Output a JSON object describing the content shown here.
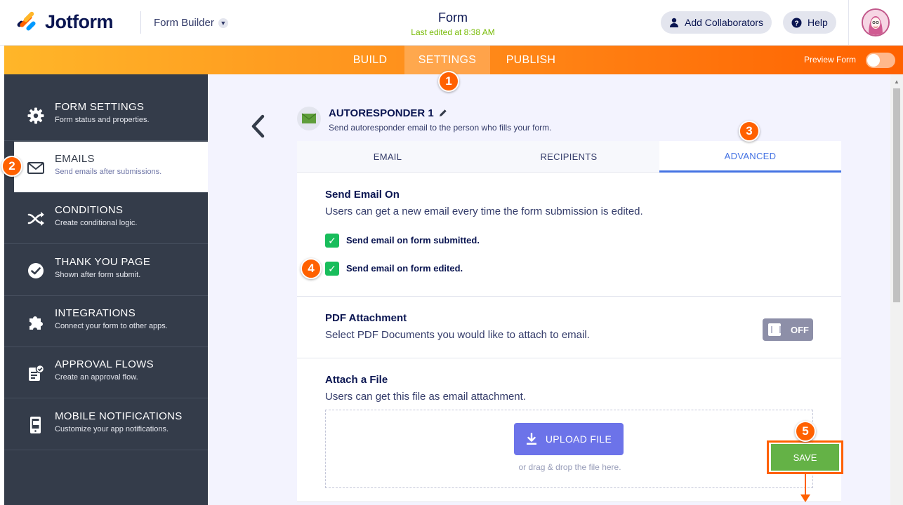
{
  "header": {
    "logo_text": "Jotform",
    "builder_label": "Form Builder",
    "form_title": "Form",
    "last_edited": "Last edited at 8:38 AM",
    "add_collaborators": "Add Collaborators",
    "help": "Help"
  },
  "nav": {
    "tabs": [
      {
        "label": "BUILD",
        "active": false
      },
      {
        "label": "SETTINGS",
        "active": true
      },
      {
        "label": "PUBLISH",
        "active": false
      }
    ],
    "preview_label": "Preview Form",
    "preview_on": false
  },
  "sidebar": {
    "items": [
      {
        "title": "FORM SETTINGS",
        "desc": "Form status and properties.",
        "icon": "gear-icon",
        "active": false
      },
      {
        "title": "EMAILS",
        "desc": "Send emails after submissions.",
        "icon": "envelope-icon",
        "active": true
      },
      {
        "title": "CONDITIONS",
        "desc": "Create conditional logic.",
        "icon": "shuffle-icon",
        "active": false
      },
      {
        "title": "THANK YOU PAGE",
        "desc": "Shown after form submit.",
        "icon": "check-circle-icon",
        "active": false
      },
      {
        "title": "INTEGRATIONS",
        "desc": "Connect your form to other apps.",
        "icon": "puzzle-icon",
        "active": false
      },
      {
        "title": "APPROVAL FLOWS",
        "desc": "Create an approval flow.",
        "icon": "approval-icon",
        "active": false
      },
      {
        "title": "MOBILE NOTIFICATIONS",
        "desc": "Customize your app notifications.",
        "icon": "mobile-icon",
        "active": false
      }
    ]
  },
  "autoresponder": {
    "title": "AUTORESPONDER 1",
    "subtitle": "Send autoresponder email to the person who fills your form."
  },
  "tabs": [
    {
      "label": "EMAIL",
      "active": false
    },
    {
      "label": "RECIPIENTS",
      "active": false
    },
    {
      "label": "ADVANCED",
      "active": true
    }
  ],
  "send_email_on": {
    "title": "Send Email On",
    "desc": "Users can get a new email every time the form submission is edited.",
    "options": [
      {
        "label": "Send email on form submitted.",
        "checked": true
      },
      {
        "label": "Send email on form edited.",
        "checked": true
      }
    ]
  },
  "pdf_attachment": {
    "title": "PDF Attachment",
    "desc": "Select PDF Documents you would like to attach to email.",
    "toggle_label": "OFF"
  },
  "attach_file": {
    "title": "Attach a File",
    "desc": "Users can get this file as email attachment.",
    "upload_label": "UPLOAD FILE",
    "drop_hint": "or drag & drop the file here."
  },
  "save_label": "SAVE",
  "badges": [
    "1",
    "2",
    "3",
    "4",
    "5"
  ],
  "colors": {
    "accent_orange": "#ff6100",
    "sidebar_bg": "#343c4a",
    "active_tab": "#4573e3",
    "check_green": "#18bd5b",
    "save_green": "#64b246",
    "upload_purple": "#6c73e9"
  }
}
